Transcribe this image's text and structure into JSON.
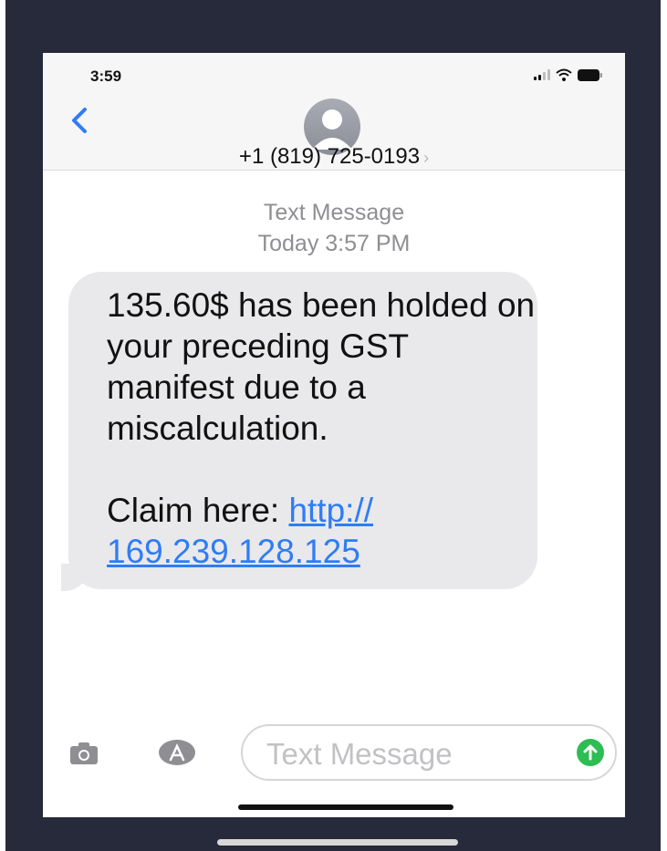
{
  "status_bar": {
    "time": "3:59"
  },
  "header": {
    "contact": "+1 (819) 725-0193",
    "contact_chevron": "›"
  },
  "thread": {
    "label": "Text Message",
    "timestamp": "Today 3:57 PM"
  },
  "message": {
    "line1": "135.60$ has been holded on your preceding GST manifest due to a miscalculation.",
    "claim_prefix": "Claim here: ",
    "link": "http:// 169.239.128.125"
  },
  "composer": {
    "placeholder": "Text Message"
  },
  "icons": {
    "back": "chevron-left-icon",
    "avatar": "person-icon",
    "camera": "camera-icon",
    "apps": "app-store-icon",
    "send": "arrow-up-icon"
  },
  "colors": {
    "link": "#2f7cf6",
    "send_button": "#2dbd52",
    "bubble": "#e9e9eb"
  }
}
